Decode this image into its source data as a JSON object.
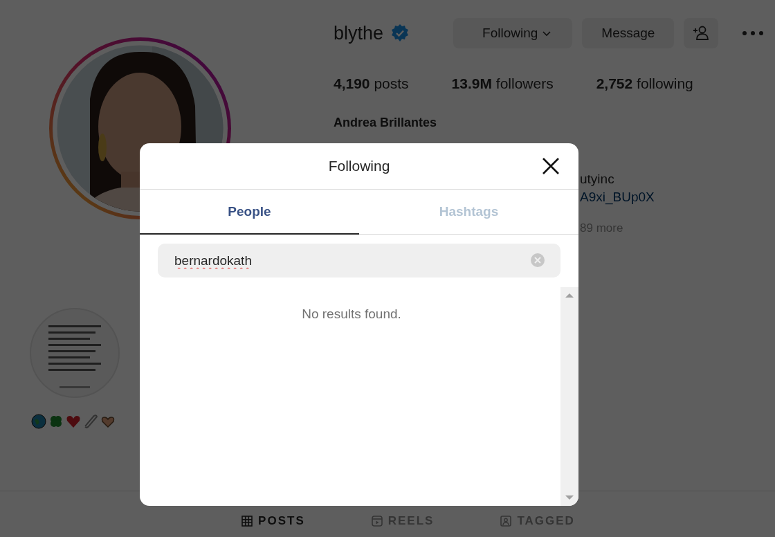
{
  "profile": {
    "username": "blythe",
    "verified": true,
    "buttons": [
      {
        "label": "Following",
        "kind": "dropdown"
      },
      {
        "label": "Message",
        "kind": "text"
      },
      {
        "kind": "add-person"
      },
      {
        "kind": "more"
      }
    ],
    "stats": [
      "**4,190** posts",
      "**13.9M** followers",
      "**2,752** following"
    ],
    "full_name": "Andrea Brillantes",
    "bio_lines": [
      {
        "text": "utyinc",
        "kind": "clover"
      },
      {
        "text": "A9xi_BUp0X",
        "kind": "link"
      },
      {
        "text": "89 more",
        "kind": "more"
      }
    ],
    "highlight": {
      "kind": "picture"
    },
    "tabs": [
      {
        "label": "POSTS",
        "kind": "grid",
        "selected": true
      },
      {
        "label": "REELS",
        "kind": "reels",
        "selected": false
      },
      {
        "label": "TAGGED",
        "kind": "tagged",
        "selected": false
      }
    ]
  },
  "dialog": {
    "title": "Following",
    "tabs": [
      {
        "label": "People",
        "selected": true
      },
      {
        "label": "Hashtags",
        "selected": false
      }
    ],
    "search": {
      "value": "bernardokath"
    },
    "message": "No results found."
  }
}
